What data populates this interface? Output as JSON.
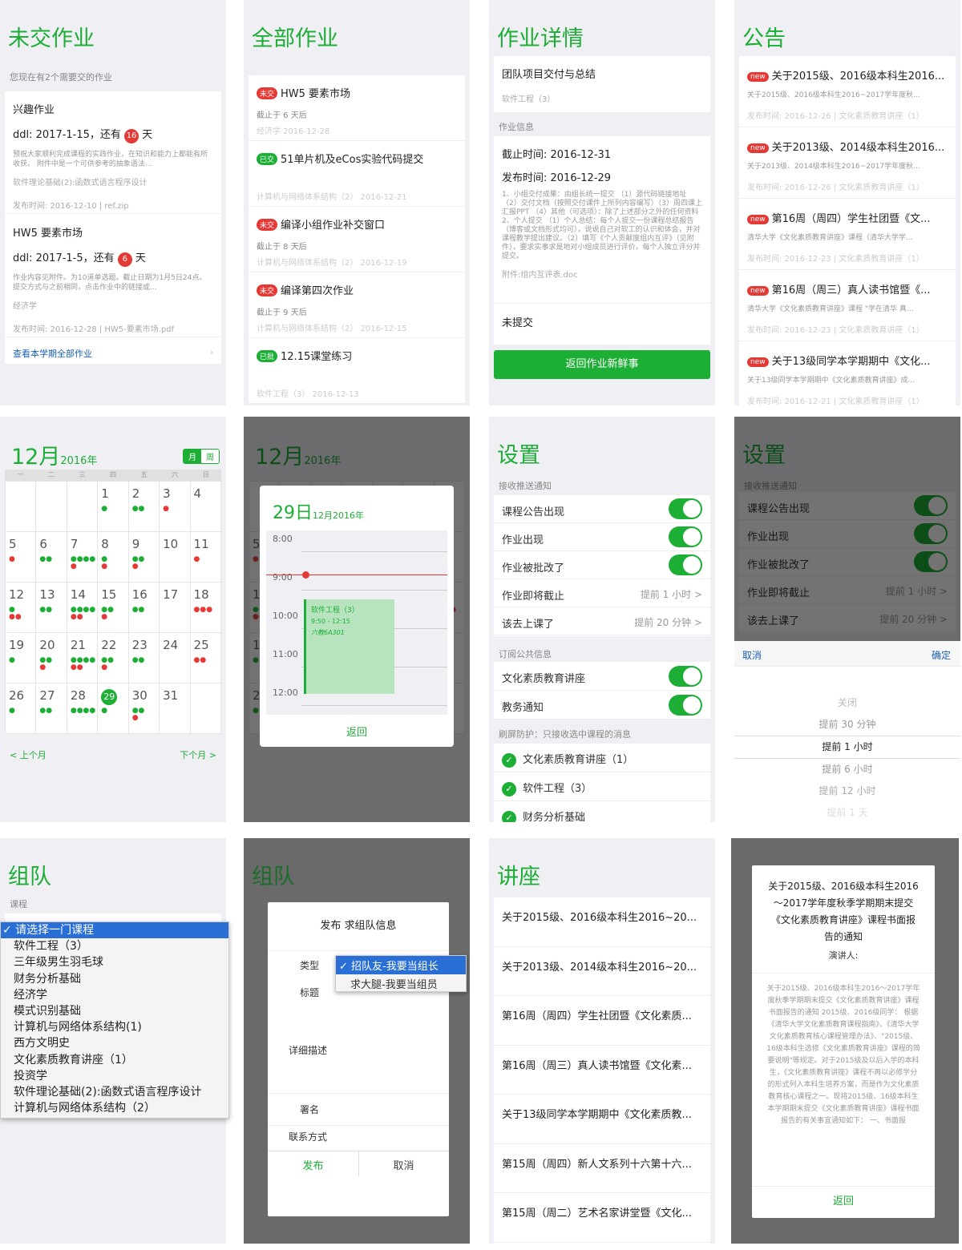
{
  "p1": {
    "title": "未交作业",
    "subtitle": "您现在有2个需要交的作业",
    "items": [
      {
        "name": "兴趣作业",
        "ddl_pre": "ddl: 2017-1-15，还有",
        "days": "16",
        "ddl_post": "天",
        "desc": "预祝大家顺利完成课程的实践作业，在知识和能力上都能有所收获。 附件中是一个可供参考的抽象语法...",
        "course": "软件理论基础(2):函数式语言程序设计",
        "meta": "发布时间: 2016-12-10  |  ref.zip"
      },
      {
        "name": "HW5 要素市场",
        "ddl_pre": "ddl: 2017-1-5，还有",
        "days": "6",
        "ddl_post": "天",
        "desc": "作业内容见附件。为10道单选题。截止日期为1月5日24点。提交方式与之前相同，点击作业中的链接或...",
        "course": "经济学",
        "meta": "发布时间: 2016-12-28  |  HW5-要素市场.pdf"
      }
    ],
    "footer": "查看本学期全部作业"
  },
  "p2": {
    "title": "全部作业",
    "items": [
      {
        "badge": "未交",
        "badge_color": "#e53935",
        "name": "HW5 要素市场",
        "line2": "截止于 6 天后",
        "line3": "经济学    2016-12-28"
      },
      {
        "badge": "已交",
        "badge_color": "#1dae36",
        "name": "51单片机及eCos实验代码提交",
        "line2": "",
        "line3": "计算机与网络体系结构（2）   2016-12-21"
      },
      {
        "badge": "未交",
        "badge_color": "#e53935",
        "name": "编译小组作业补交窗口",
        "line2": "截止于 8 天后",
        "line3": "计算机与网络体系结构（2）   2016-12-19"
      },
      {
        "badge": "未交",
        "badge_color": "#e53935",
        "name": "编译第四次作业",
        "line2": "截止于 9 天后",
        "line3": "计算机与网络体系结构（2）   2016-12-15"
      },
      {
        "badge": "已批",
        "badge_color": "#1dae36",
        "name": "12.15课堂练习",
        "line2": "",
        "line3": "软件工程（3）   2016-12-13"
      }
    ]
  },
  "p3": {
    "title": "作业详情",
    "name": "团队项目交付与总结",
    "course": "软件工程（3）",
    "section": "作业信息",
    "deadline": "截止时间: 2016-12-31",
    "published": "发布时间: 2016-12-29",
    "desc": "1、小组交付成果：由组长统一提交 （1）源代码链接地址 （2）交付文档（按照交付课件上所列内容编写）（3）周四课上汇报PPT （4）其他（可选项）：除了上述部分之外的任何资料 2、个人提交 （1）个人总结：每个人提交一份课程总结报告（博客或文档形式均可），说说自己对软工的认识和体会，并对课程教学提出建议。（2）填写《个人贡献度组内互评》（见附件），要求实事求是地对小组成员进行评价，每个人独立评分并提交。",
    "attach": "附件:组内互评表.doc",
    "status": "未提交",
    "button": "返回作业新鲜事"
  },
  "p4": {
    "title": "公告",
    "items": [
      {
        "tag": "new",
        "title": "关于2015级、2016级本科生2016...",
        "sub": "关于2015级、2016级本科生2016~2017学年度秋...",
        "meta": "发布时间: 2016-12-26  |  文化素质教育讲座（1）"
      },
      {
        "tag": "new",
        "title": "关于2013级、2014级本科生2016...",
        "sub": "关于2013级、2014级本科生2016~2017学年度秋...",
        "meta": "发布时间: 2016-12-26  |  文化素质教育讲座（1）"
      },
      {
        "tag": "new",
        "title": "第16周（周四）学生社团暨《文...",
        "sub": "清华大学《文化素质教育讲座》课程（清华大学学...",
        "meta": "发布时间: 2016-12-23  |  文化素质教育讲座（1）"
      },
      {
        "tag": "new",
        "title": "第16周（周三）真人读书馆暨《...",
        "sub": "清华大学《文化素质教育讲座》课程 \"学在清华 真...",
        "meta": "发布时间: 2016-12-23  |  文化素质教育讲座（1）"
      },
      {
        "tag": "new",
        "title": "关于13级同学本学期期中《文化...",
        "sub": "关于13级同学本学期期中《文化素质教育讲座》成...",
        "meta": "发布时间: 2016-12-21  |  文化素质教育讲座（1）"
      }
    ]
  },
  "cal": {
    "month": "12月",
    "year": "2016年",
    "toggle_month": "月",
    "toggle_week": "周",
    "weekdays": [
      "一",
      "二",
      "三",
      "四",
      "五",
      "六",
      "日"
    ],
    "prev": "< 上个月",
    "next": "下个月 >",
    "weeks": [
      [
        {
          "d": "",
          "g": "",
          "r": ""
        },
        {
          "d": "",
          "g": "",
          "r": ""
        },
        {
          "d": "",
          "g": "",
          "r": ""
        },
        {
          "d": "1",
          "g": "●",
          "r": ""
        },
        {
          "d": "2",
          "g": "●●",
          "r": ""
        },
        {
          "d": "3",
          "g": "",
          "r": "●"
        },
        {
          "d": "4",
          "g": "",
          "r": ""
        }
      ],
      [
        {
          "d": "5",
          "g": "",
          "r": "●"
        },
        {
          "d": "6",
          "g": "●●",
          "r": ""
        },
        {
          "d": "7",
          "g": "●●●●",
          "r": "●"
        },
        {
          "d": "8",
          "g": "●",
          "r": "●"
        },
        {
          "d": "9",
          "g": "●●",
          "r": "●"
        },
        {
          "d": "10",
          "g": "",
          "r": ""
        },
        {
          "d": "11",
          "g": "",
          "r": "●"
        }
      ],
      [
        {
          "d": "12",
          "g": "●",
          "r": "●●"
        },
        {
          "d": "13",
          "g": "●●",
          "r": ""
        },
        {
          "d": "14",
          "g": "●●●●",
          "r": "●●"
        },
        {
          "d": "15",
          "g": "●●",
          "r": "●"
        },
        {
          "d": "16",
          "g": "●●",
          "r": ""
        },
        {
          "d": "17",
          "g": "",
          "r": ""
        },
        {
          "d": "18",
          "g": "",
          "r": "●●●"
        }
      ],
      [
        {
          "d": "19",
          "g": "●",
          "r": ""
        },
        {
          "d": "20",
          "g": "●●",
          "r": "●"
        },
        {
          "d": "21",
          "g": "●●●●",
          "r": "●●"
        },
        {
          "d": "22",
          "g": "●●",
          "r": "●"
        },
        {
          "d": "23",
          "g": "●●",
          "r": ""
        },
        {
          "d": "24",
          "g": "",
          "r": ""
        },
        {
          "d": "25",
          "g": "",
          "r": "●●"
        }
      ],
      [
        {
          "d": "26",
          "g": "●",
          "r": ""
        },
        {
          "d": "27",
          "g": "●●",
          "r": ""
        },
        {
          "d": "28",
          "g": "●●●●",
          "r": ""
        },
        {
          "d": "29",
          "g": "●",
          "r": ""
        },
        {
          "d": "30",
          "g": "●●",
          "r": "●"
        },
        {
          "d": "31",
          "g": "",
          "r": ""
        },
        {
          "d": "",
          "g": "",
          "r": ""
        }
      ]
    ]
  },
  "day": {
    "day": "29日",
    "month": "12月2016年",
    "hours": [
      "8:00",
      "9:00",
      "10:00",
      "11:00",
      "12:00"
    ],
    "event": {
      "name": "软件工程（3）",
      "time": "9:50 - 12:15",
      "room": "六教6A301"
    },
    "back": "返回"
  },
  "settings": {
    "title": "设置",
    "section1": "接收推送通知",
    "rows": [
      {
        "label": "课程公告出现",
        "value": ""
      },
      {
        "label": "作业出现",
        "value": ""
      },
      {
        "label": "作业被批改了",
        "value": ""
      },
      {
        "label": "作业即将截止",
        "value": "提前 1 小时 >"
      },
      {
        "label": "该去上课了",
        "value": "提前 20 分钟 >"
      }
    ],
    "section2": "订阅公共信息",
    "subs": [
      "文化素质教育讲座",
      "教务通知"
    ],
    "section3": "刷屏防护：只接收选中课程的消息",
    "courses": [
      "文化素质教育讲座（1）",
      "软件工程（3）",
      "财务分析基础"
    ]
  },
  "picker": {
    "cancel": "取消",
    "ok": "确定",
    "options": [
      "关闭",
      "提前 30 分钟",
      "提前 1 小时",
      "提前 6 小时",
      "提前 12 小时",
      "提前 1 天"
    ]
  },
  "team": {
    "title": "组队",
    "label": "课程",
    "options": [
      "✓ 请选择一门课程",
      "软件工程（3）",
      "三年级男生羽毛球",
      "财务分析基础",
      "经济学",
      "模式识别基础",
      "计算机与网络体系结构(1)",
      "西方文明史",
      "文化素质教育讲座（1）",
      "投资学",
      "软件理论基础(2):函数式语言程序设计",
      "计算机与网络体系结构（2）"
    ]
  },
  "post": {
    "title": "发布 求组队信息",
    "type_label": "类型",
    "type_opt1": "✓ 招队友-我要当组长",
    "type_opt2": "求大腿-我要当组员",
    "title_label": "标题",
    "desc_label": "详细描述",
    "sign_label": "署名",
    "contact_label": "联系方式",
    "publish": "发布",
    "cancel": "取消"
  },
  "lectures": {
    "title": "讲座",
    "items": [
      "关于2015级、2016级本科生2016~20...",
      "关于2013级、2014级本科生2016~20...",
      "第16周（周四）学生社团暨《文化素质...",
      "第16周（周三）真人读书馆暨《文化素...",
      "关于13级同学本学期期中《文化素质教...",
      "第15周（周四）新人文系列十六第十六...",
      "第15周（周二）艺术名家讲堂暨《文化..."
    ]
  },
  "lecture_dlg": {
    "title": "关于2015级、2016级本科生2016～2017学年度秋季学期期末提交《文化素质教育讲座》课程书面报告的通知",
    "speaker": "演讲人:",
    "body": "关于2015级、2016级本科生2016～2017学年度秋季学期期末提交《文化素质教育讲座》课程书面报告的通知 2015级、2016级同学： 根据《清华大学文化素质教育课程指南》、《清华大学文化素质教育核心课程管理办法》、\"2015级、16级本科生选修《文化素质教育讲座》课程的简要说明\"等规定。对于2015级及以后入学的本科生，《文化素质教育讲座》课程不再以必修学分的形式列入本科生培养方案，而是作为文化素质教育核心课程之一。现将2015级、16级本科生本学期期末提交《文化素质教育讲座》课程书面报告的有关事宜通知如下： 一、书面报",
    "back": "返回"
  }
}
